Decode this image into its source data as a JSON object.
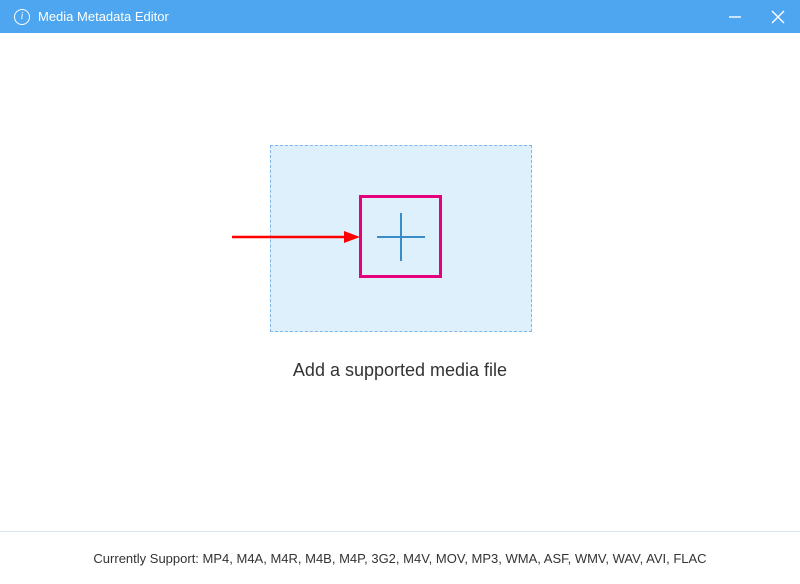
{
  "titlebar": {
    "info_glyph": "i",
    "title": "Media Metadata Editor"
  },
  "main": {
    "caption": "Add a supported media file"
  },
  "footer": {
    "label": "Currently Support: ",
    "formats": "MP4, M4A, M4R, M4B, M4P, 3G2, M4V, MOV, MP3, WMA, ASF, WMV, WAV, AVI, FLAC"
  },
  "colors": {
    "accent": "#4da6ef",
    "dropzone_bg": "#def0fc",
    "dropzone_border": "#7fb8e8",
    "highlight_box": "#e6007e",
    "arrow": "#ff0000",
    "plus": "#3a8cc9"
  }
}
